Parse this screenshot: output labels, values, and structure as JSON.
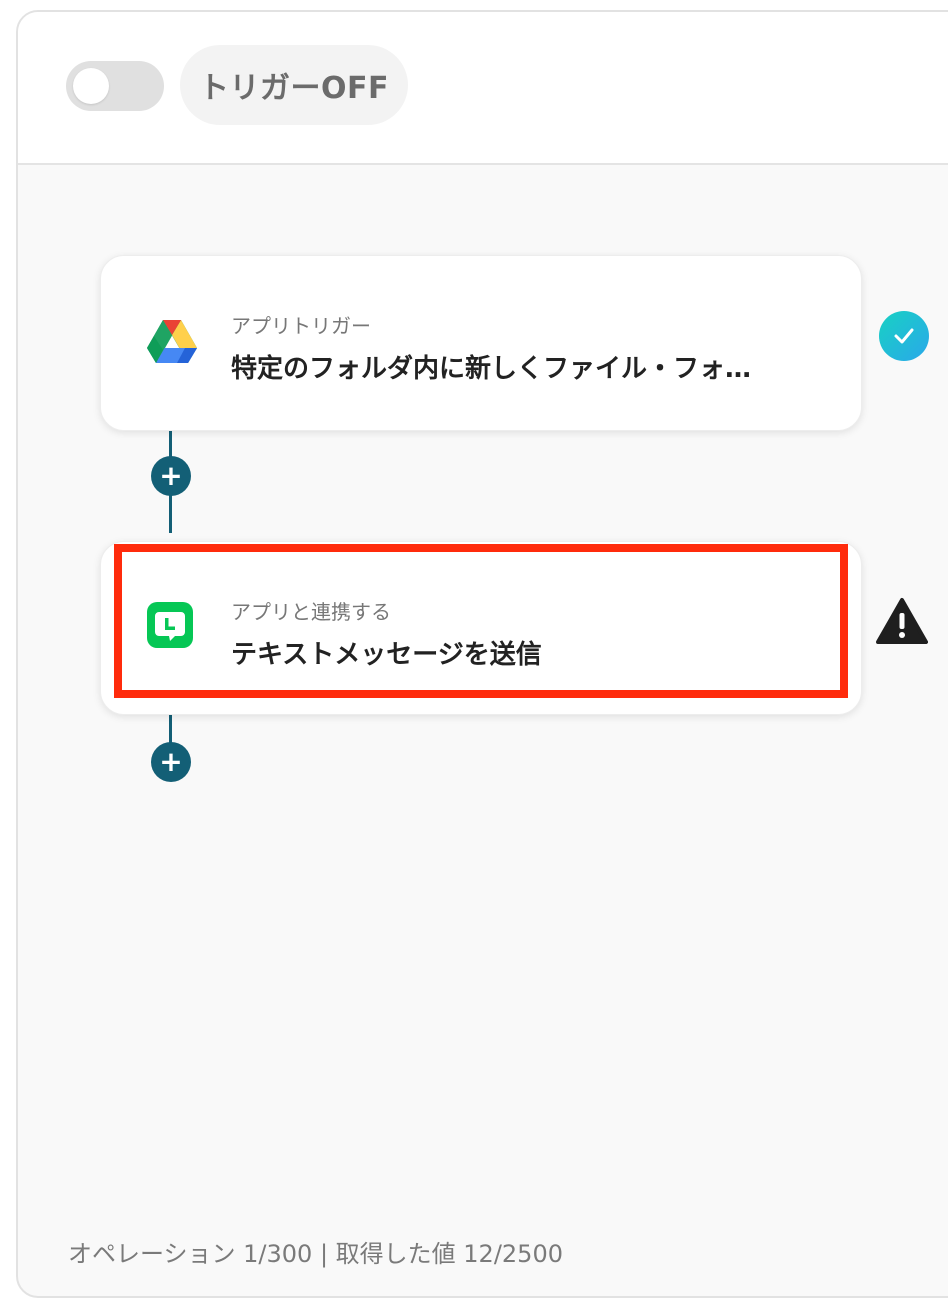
{
  "header": {
    "toggle_state": "off",
    "trigger_label": "トリガーOFF"
  },
  "steps": [
    {
      "subtitle": "アプリトリガー",
      "title": "特定のフォルダ内に新しくファイル・フォ…",
      "app_icon": "google-drive-icon",
      "status_icon": "check-circle-icon"
    },
    {
      "subtitle": "アプリと連携する",
      "title": "テキストメッセージを送信",
      "app_icon": "line-icon",
      "status_icon": "warning-icon"
    }
  ],
  "plus_label": "+",
  "footer": {
    "text": "オペレーション 1/300 | 取得した値 12/2500"
  },
  "colors": {
    "accent": "#135f76",
    "highlight": "#ff2b0c",
    "check": "#1ec7d0",
    "line_green": "#06c755"
  }
}
